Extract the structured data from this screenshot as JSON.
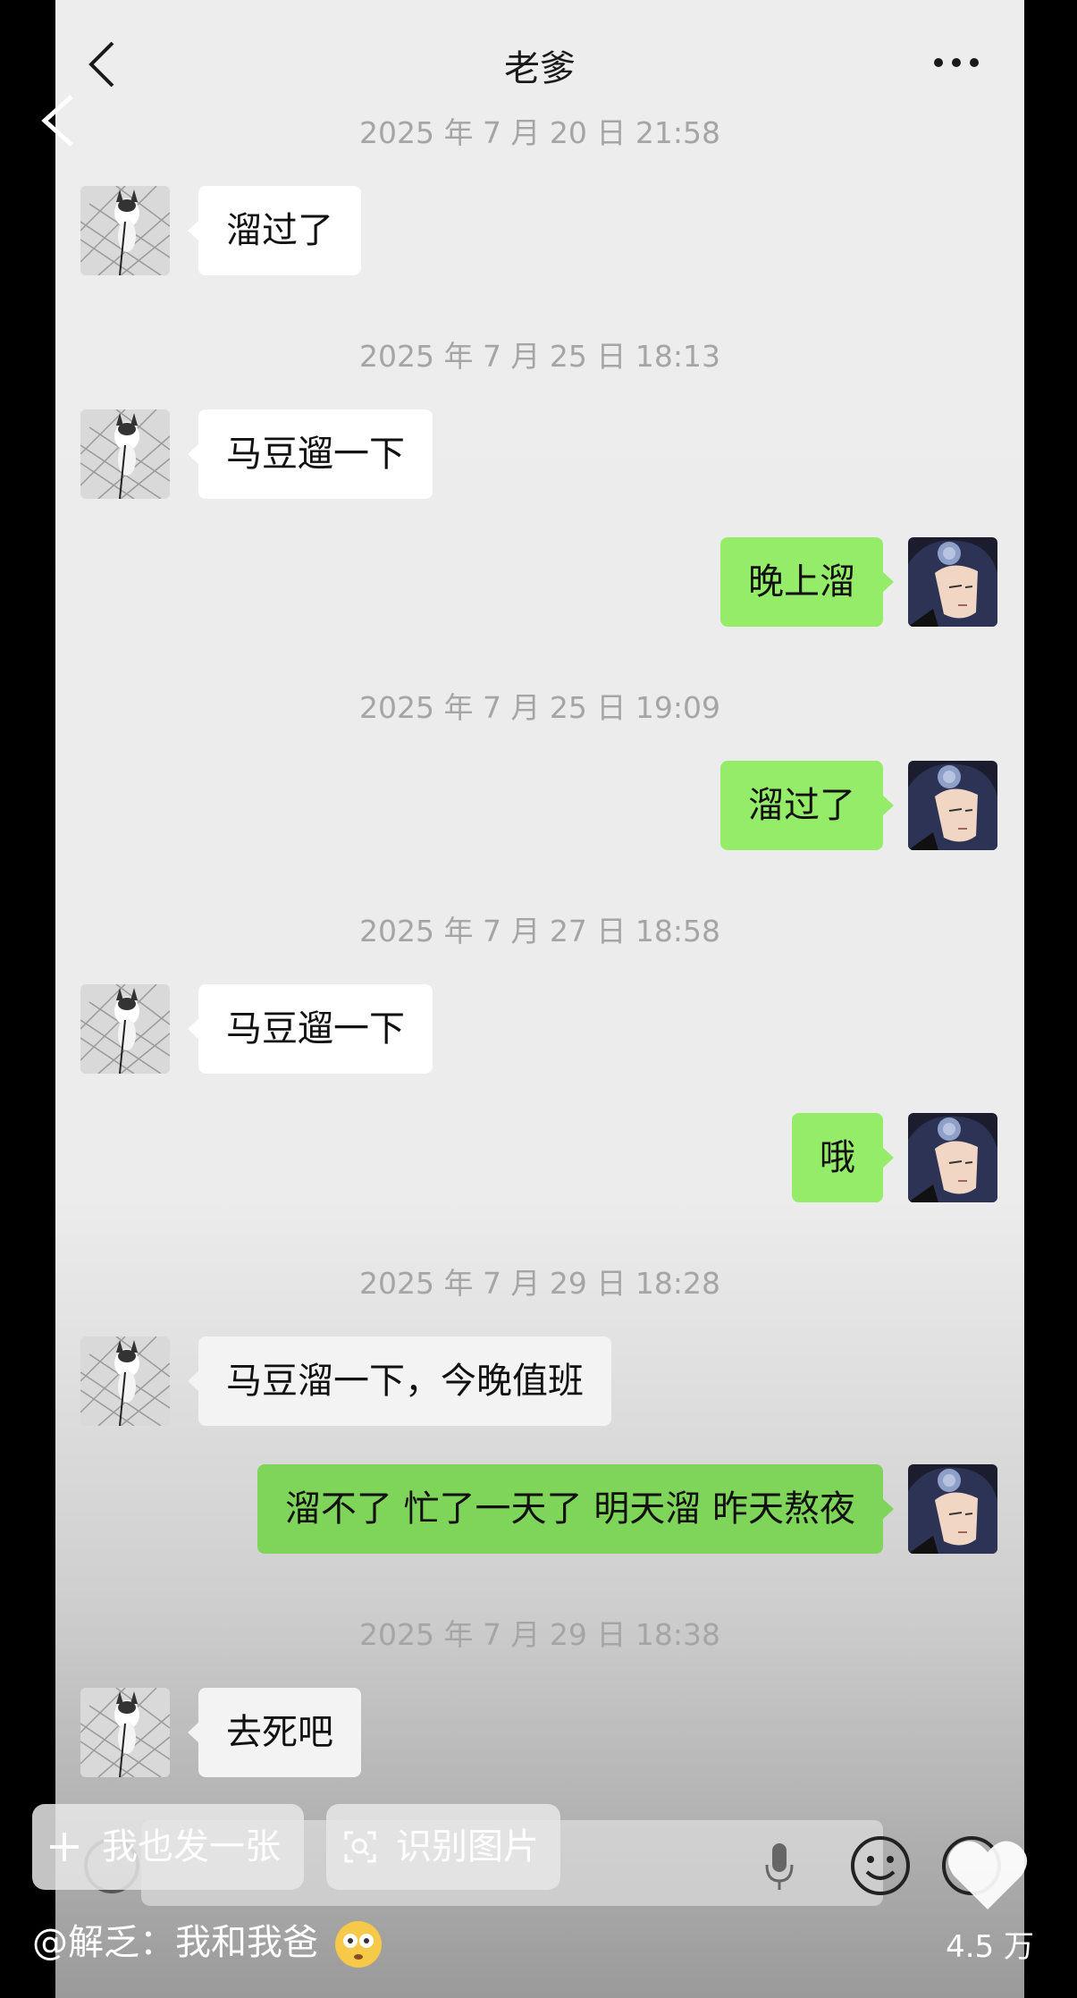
{
  "header": {
    "title": "老爹",
    "back_icon": "chevron-left-icon",
    "more_icon": "more-dots-icon"
  },
  "messages": [
    {
      "timestamp": "2025 年 7 月 20 日 21:58"
    },
    {
      "from": "dad",
      "text": "溜过了"
    },
    {
      "timestamp": "2025 年 7 月 25 日 18:13"
    },
    {
      "from": "dad",
      "text": "马豆遛一下"
    },
    {
      "from": "me",
      "text": "晚上溜"
    },
    {
      "timestamp": "2025 年 7 月 25 日 19:09"
    },
    {
      "from": "me",
      "text": "溜过了"
    },
    {
      "timestamp": "2025 年 7 月 27 日 18:58"
    },
    {
      "from": "dad",
      "text": "马豆遛一下"
    },
    {
      "from": "me",
      "text": "哦"
    },
    {
      "timestamp": "2025 年 7 月 29 日 18:28"
    },
    {
      "from": "dad",
      "text": "马豆溜一下，今晚值班"
    },
    {
      "from": "me",
      "text": "溜不了 忙了一天了 明天溜 昨天熬夜"
    },
    {
      "timestamp": "2025 年 7 月 29 日 18:38"
    },
    {
      "from": "dad",
      "text": "去死吧"
    }
  ],
  "overlay": {
    "post_button": "我也发一张",
    "recognize_button": "识别图片",
    "caption": "@解乏：我和我爸",
    "like_count": "4.5 万"
  },
  "colors": {
    "my_bubble": "#95ec69",
    "dad_bubble": "#ffffff",
    "chat_bg": "#ededed"
  }
}
